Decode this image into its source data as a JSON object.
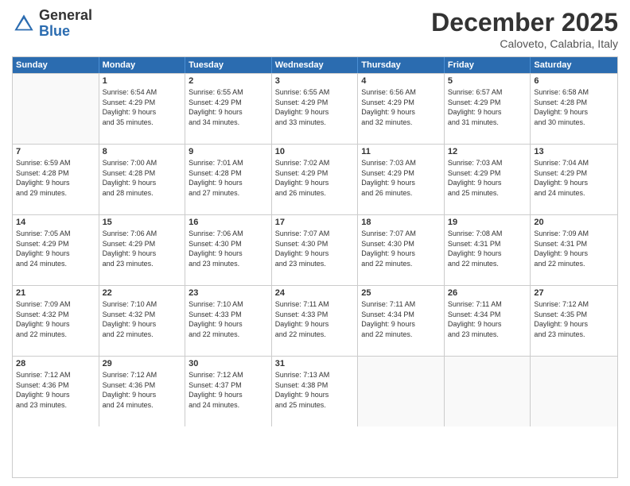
{
  "logo": {
    "text_general": "General",
    "text_blue": "Blue"
  },
  "header": {
    "title": "December 2025",
    "subtitle": "Caloveto, Calabria, Italy"
  },
  "calendar": {
    "days_of_week": [
      "Sunday",
      "Monday",
      "Tuesday",
      "Wednesday",
      "Thursday",
      "Friday",
      "Saturday"
    ],
    "rows": [
      [
        {
          "day": "",
          "lines": []
        },
        {
          "day": "1",
          "lines": [
            "Sunrise: 6:54 AM",
            "Sunset: 4:29 PM",
            "Daylight: 9 hours",
            "and 35 minutes."
          ]
        },
        {
          "day": "2",
          "lines": [
            "Sunrise: 6:55 AM",
            "Sunset: 4:29 PM",
            "Daylight: 9 hours",
            "and 34 minutes."
          ]
        },
        {
          "day": "3",
          "lines": [
            "Sunrise: 6:55 AM",
            "Sunset: 4:29 PM",
            "Daylight: 9 hours",
            "and 33 minutes."
          ]
        },
        {
          "day": "4",
          "lines": [
            "Sunrise: 6:56 AM",
            "Sunset: 4:29 PM",
            "Daylight: 9 hours",
            "and 32 minutes."
          ]
        },
        {
          "day": "5",
          "lines": [
            "Sunrise: 6:57 AM",
            "Sunset: 4:29 PM",
            "Daylight: 9 hours",
            "and 31 minutes."
          ]
        },
        {
          "day": "6",
          "lines": [
            "Sunrise: 6:58 AM",
            "Sunset: 4:28 PM",
            "Daylight: 9 hours",
            "and 30 minutes."
          ]
        }
      ],
      [
        {
          "day": "7",
          "lines": [
            "Sunrise: 6:59 AM",
            "Sunset: 4:28 PM",
            "Daylight: 9 hours",
            "and 29 minutes."
          ]
        },
        {
          "day": "8",
          "lines": [
            "Sunrise: 7:00 AM",
            "Sunset: 4:28 PM",
            "Daylight: 9 hours",
            "and 28 minutes."
          ]
        },
        {
          "day": "9",
          "lines": [
            "Sunrise: 7:01 AM",
            "Sunset: 4:28 PM",
            "Daylight: 9 hours",
            "and 27 minutes."
          ]
        },
        {
          "day": "10",
          "lines": [
            "Sunrise: 7:02 AM",
            "Sunset: 4:29 PM",
            "Daylight: 9 hours",
            "and 26 minutes."
          ]
        },
        {
          "day": "11",
          "lines": [
            "Sunrise: 7:03 AM",
            "Sunset: 4:29 PM",
            "Daylight: 9 hours",
            "and 26 minutes."
          ]
        },
        {
          "day": "12",
          "lines": [
            "Sunrise: 7:03 AM",
            "Sunset: 4:29 PM",
            "Daylight: 9 hours",
            "and 25 minutes."
          ]
        },
        {
          "day": "13",
          "lines": [
            "Sunrise: 7:04 AM",
            "Sunset: 4:29 PM",
            "Daylight: 9 hours",
            "and 24 minutes."
          ]
        }
      ],
      [
        {
          "day": "14",
          "lines": [
            "Sunrise: 7:05 AM",
            "Sunset: 4:29 PM",
            "Daylight: 9 hours",
            "and 24 minutes."
          ]
        },
        {
          "day": "15",
          "lines": [
            "Sunrise: 7:06 AM",
            "Sunset: 4:29 PM",
            "Daylight: 9 hours",
            "and 23 minutes."
          ]
        },
        {
          "day": "16",
          "lines": [
            "Sunrise: 7:06 AM",
            "Sunset: 4:30 PM",
            "Daylight: 9 hours",
            "and 23 minutes."
          ]
        },
        {
          "day": "17",
          "lines": [
            "Sunrise: 7:07 AM",
            "Sunset: 4:30 PM",
            "Daylight: 9 hours",
            "and 23 minutes."
          ]
        },
        {
          "day": "18",
          "lines": [
            "Sunrise: 7:07 AM",
            "Sunset: 4:30 PM",
            "Daylight: 9 hours",
            "and 22 minutes."
          ]
        },
        {
          "day": "19",
          "lines": [
            "Sunrise: 7:08 AM",
            "Sunset: 4:31 PM",
            "Daylight: 9 hours",
            "and 22 minutes."
          ]
        },
        {
          "day": "20",
          "lines": [
            "Sunrise: 7:09 AM",
            "Sunset: 4:31 PM",
            "Daylight: 9 hours",
            "and 22 minutes."
          ]
        }
      ],
      [
        {
          "day": "21",
          "lines": [
            "Sunrise: 7:09 AM",
            "Sunset: 4:32 PM",
            "Daylight: 9 hours",
            "and 22 minutes."
          ]
        },
        {
          "day": "22",
          "lines": [
            "Sunrise: 7:10 AM",
            "Sunset: 4:32 PM",
            "Daylight: 9 hours",
            "and 22 minutes."
          ]
        },
        {
          "day": "23",
          "lines": [
            "Sunrise: 7:10 AM",
            "Sunset: 4:33 PM",
            "Daylight: 9 hours",
            "and 22 minutes."
          ]
        },
        {
          "day": "24",
          "lines": [
            "Sunrise: 7:11 AM",
            "Sunset: 4:33 PM",
            "Daylight: 9 hours",
            "and 22 minutes."
          ]
        },
        {
          "day": "25",
          "lines": [
            "Sunrise: 7:11 AM",
            "Sunset: 4:34 PM",
            "Daylight: 9 hours",
            "and 22 minutes."
          ]
        },
        {
          "day": "26",
          "lines": [
            "Sunrise: 7:11 AM",
            "Sunset: 4:34 PM",
            "Daylight: 9 hours",
            "and 23 minutes."
          ]
        },
        {
          "day": "27",
          "lines": [
            "Sunrise: 7:12 AM",
            "Sunset: 4:35 PM",
            "Daylight: 9 hours",
            "and 23 minutes."
          ]
        }
      ],
      [
        {
          "day": "28",
          "lines": [
            "Sunrise: 7:12 AM",
            "Sunset: 4:36 PM",
            "Daylight: 9 hours",
            "and 23 minutes."
          ]
        },
        {
          "day": "29",
          "lines": [
            "Sunrise: 7:12 AM",
            "Sunset: 4:36 PM",
            "Daylight: 9 hours",
            "and 24 minutes."
          ]
        },
        {
          "day": "30",
          "lines": [
            "Sunrise: 7:12 AM",
            "Sunset: 4:37 PM",
            "Daylight: 9 hours",
            "and 24 minutes."
          ]
        },
        {
          "day": "31",
          "lines": [
            "Sunrise: 7:13 AM",
            "Sunset: 4:38 PM",
            "Daylight: 9 hours",
            "and 25 minutes."
          ]
        },
        {
          "day": "",
          "lines": []
        },
        {
          "day": "",
          "lines": []
        },
        {
          "day": "",
          "lines": []
        }
      ]
    ]
  }
}
